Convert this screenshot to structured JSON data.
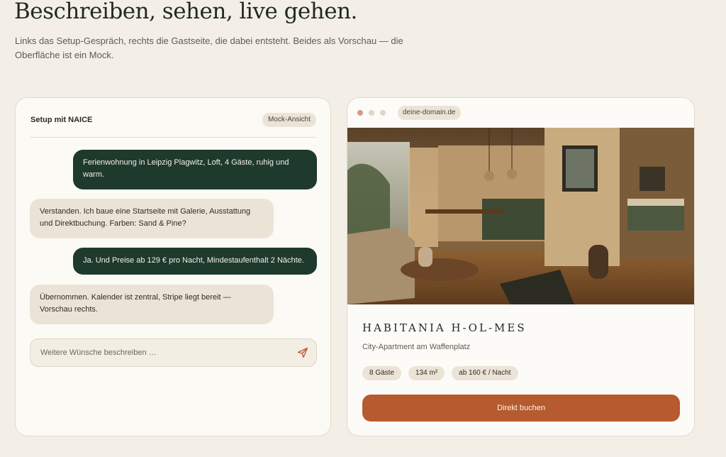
{
  "page": {
    "headline": "Beschreiben, sehen, live gehen.",
    "subtext": "Links das Setup-Gespräch, rechts die Gastseite, die dabei entsteht. Beides als Vorschau — die Oberfläche ist ein Mock."
  },
  "chat": {
    "title": "Setup mit NAICE",
    "badge": "Mock-Ansicht",
    "messages": [
      {
        "role": "user",
        "text": "Ferienwohnung in Leipzig Plagwitz, Loft, 4 Gäste, ruhig und warm."
      },
      {
        "role": "assistant",
        "text": "Verstanden. Ich baue eine Startseite mit Galerie, Ausstattung und Direktbuchung. Farben: Sand & Pine?"
      },
      {
        "role": "user",
        "text": "Ja. Und Preise ab 129 € pro Nacht, Mindestaufenthalt 2 Nächte."
      },
      {
        "role": "assistant",
        "text": "Übernommen. Kalender ist zentral, Stripe liegt bereit — Vorschau rechts."
      }
    ],
    "input_placeholder": "Weitere Wünsche beschreiben …",
    "send_icon": "send-icon"
  },
  "preview": {
    "url": "deine-domain.de",
    "brand": "HABITANIA H-OL-MES",
    "tagline": "City-Apartment am Waffenplatz",
    "chips": [
      "8 Gäste",
      "134 m²",
      "ab 160 € / Nacht"
    ],
    "cta": "Direkt buchen"
  },
  "colors": {
    "background": "#f4efe6",
    "pine": "#1e3a2d",
    "sand": "#ebe4d6",
    "accent": "#b65a30"
  }
}
